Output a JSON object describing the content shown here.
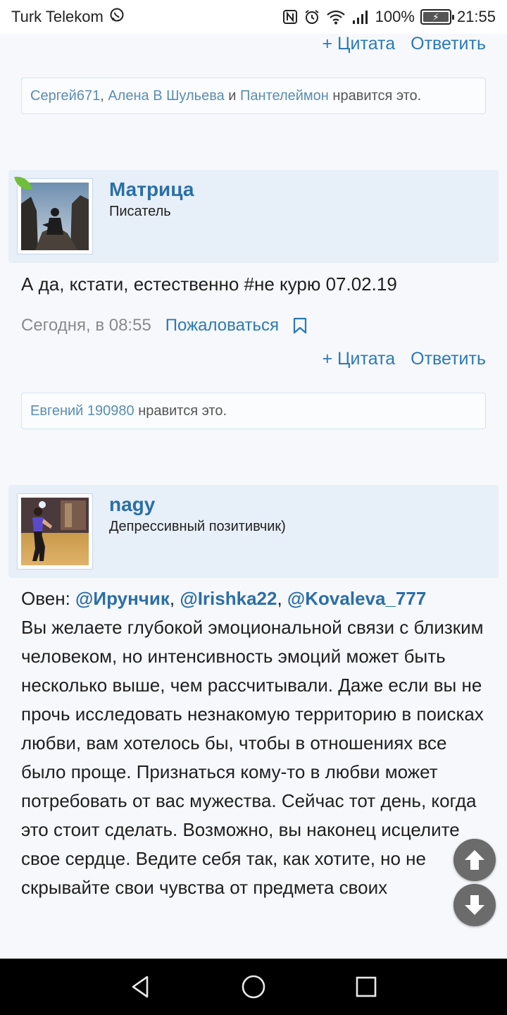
{
  "status_bar": {
    "carrier": "Turk Telekom",
    "battery": "100%",
    "time": "21:55"
  },
  "post1_tail": {
    "actions": {
      "quote": "+ Цитата",
      "reply": "Ответить"
    },
    "likes": {
      "user1": "Сергей671",
      "sep1": ",",
      "user2": "Алена В Шульева",
      "and": "и",
      "user3": "Пантелеймон",
      "suffix": "нравится это."
    }
  },
  "post2": {
    "username": "Матрица",
    "user_title": "Писатель",
    "text": "А да, кстати, естественно #не курю 07.02.19",
    "date": "Сегодня, в 08:55",
    "report": "Пожаловаться",
    "actions": {
      "quote": "+ Цитата",
      "reply": "Ответить"
    },
    "likes": {
      "user1": "Евгений 190980",
      "suffix": "нравится это."
    }
  },
  "post3": {
    "username": "nagy",
    "user_title": "Депрессивный позитивчик)",
    "prefix": "Овен:",
    "mentions": [
      "@Ирунчик",
      "@Irishka22",
      "@Kovaleva_777"
    ],
    "separator": ",",
    "body": "Вы желаете глубокой эмоциональной связи с близким человеком, но интенсивность эмоций может быть несколько выше, чем рассчитывали. Даже если вы не прочь исследовать незнакомую территорию в поисках любви, вам хотелось бы, чтобы в отношениях все было проще. Признаться кому-то в любви может потребовать от вас мужества. Сейчас тот день, когда это стоит сделать. Возможно, вы наконец исцелите свое сердце. Ведите себя так, как хотите, но не скрывайте свои чувства от предмета своих"
  },
  "icons": {
    "whatsapp": "whatsapp-icon",
    "nfc": "nfc-icon",
    "alarm": "alarm-icon",
    "wifi": "wifi-icon",
    "signal": "signal-icon",
    "bookmark": "bookmark-icon",
    "scroll_up": "arrow-up-icon",
    "scroll_down": "arrow-down-icon",
    "back": "back-icon",
    "home": "home-icon",
    "recents": "recents-icon"
  },
  "colors": {
    "link": "#2b7ab7",
    "username": "#2b6fa6",
    "header_bg": "#e7eff8",
    "page_bg": "#f7f8fc"
  }
}
